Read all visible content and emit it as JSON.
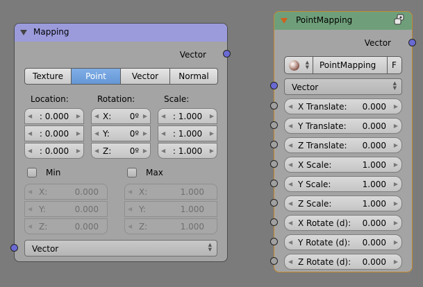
{
  "mapping_node": {
    "title": "Mapping",
    "header_color": "#9b9bdc",
    "output_label": "Vector",
    "tabs": [
      "Texture",
      "Point",
      "Vector",
      "Normal"
    ],
    "active_tab": "Point",
    "location_label": "Location:",
    "rotation_label": "Rotation:",
    "scale_label": "Scale:",
    "location": [
      ": 0.000",
      ": 0.000",
      ": 0.000"
    ],
    "rotation": [
      {
        "axis": "X:",
        "value": "0º"
      },
      {
        "axis": "Y:",
        "value": "0º"
      },
      {
        "axis": "Z:",
        "value": "0º"
      }
    ],
    "scale": [
      ": 1.000",
      ": 1.000",
      ": 1.000"
    ],
    "min_label": "Min",
    "max_label": "Max",
    "min": [
      {
        "axis": "X:",
        "value": "0.000"
      },
      {
        "axis": "Y:",
        "value": "0.000"
      },
      {
        "axis": "Z:",
        "value": "0.000"
      }
    ],
    "max": [
      {
        "axis": "X:",
        "value": "1.000"
      },
      {
        "axis": "Y:",
        "value": "1.000"
      },
      {
        "axis": "Z:",
        "value": "1.000"
      }
    ],
    "vector_type": "Vector"
  },
  "point_node": {
    "title": "PointMapping",
    "header_color": "#6f9f7a",
    "output_label": "Vector",
    "datablock_name": "PointMapping",
    "fake_user": "F",
    "vector_type": "Vector",
    "params": [
      {
        "label": "X Translate:",
        "value": "0.000"
      },
      {
        "label": "Y Translate:",
        "value": "0.000"
      },
      {
        "label": "Z Translate:",
        "value": "0.000"
      },
      {
        "label": "X Scale:",
        "value": "1.000"
      },
      {
        "label": "Y Scale:",
        "value": "1.000"
      },
      {
        "label": "Z Scale:",
        "value": "1.000"
      },
      {
        "label": "X Rotate (d):",
        "value": "0.000"
      },
      {
        "label": "Y Rotate (d):",
        "value": "0.000"
      },
      {
        "label": "Z Rotate (d):",
        "value": "0.000"
      }
    ]
  }
}
